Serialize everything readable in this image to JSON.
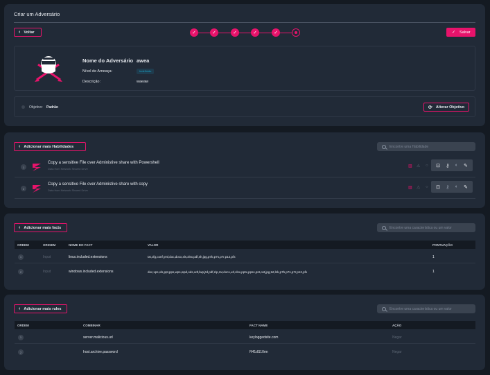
{
  "header": {
    "title": "Criar um Adversário",
    "back_label": "Voltar",
    "save_label": "Salvar",
    "steps": [
      "done",
      "done",
      "done",
      "done",
      "done",
      "current"
    ]
  },
  "adversary": {
    "name_label": "Nome do Adversário",
    "name_value": "awea",
    "threat_label": "Nível de Ameaça:",
    "threat_value": "Indefinido",
    "description_label": "Descrição:",
    "description_value": "waeaw"
  },
  "objective": {
    "label": "Objetivo:",
    "value": "Padrão",
    "change_label": "Alterar Objetivo"
  },
  "abilities": {
    "add_label": "Adicionar mais Habilidades",
    "search_placeholder": "Encontre uma Habilidade",
    "items": [
      {
        "index": "1",
        "title": "Copy a sensitive File over Administive share with Powershell",
        "subtitle": "Data from Network Shared Drive"
      },
      {
        "index": "2",
        "title": "Copy a sensitive File over Administive share with copy",
        "subtitle": "Data from Network Shared Drive"
      }
    ]
  },
  "facts": {
    "add_label": "Adicionar mais facts",
    "search_placeholder": "Encontre uma característica ou um valor",
    "columns": [
      "ORDEM",
      "ORIGEM",
      "NOME DO FACT",
      "VALOR",
      "PONTUAÇÃO"
    ],
    "rows": [
      {
        "order": "1",
        "origin": "Input",
        "name": "linux.included.extensions",
        "value": "txt,cfg,conf,yml,doc,docx,xls,xlsx,pdf,sh,jpg,p7b,p7s,p7r,p12,pfx",
        "score": "1"
      },
      {
        "order": "2",
        "origin": "Input",
        "name": "windows.included.extensions",
        "value": "doc,xps,xls,ppt,pps,wps,wpd,ods,odt,lwp,jtd,pdf,zip,rar,docx,url,xlsx,pptx,ppsx,pst,ost,jpg,txt,lnk,p7b,p7s,p7r,p12,pfx",
        "score": "1"
      }
    ]
  },
  "rules": {
    "add_label": "Adicionar mais rules",
    "search_placeholder": "Encontre uma característica ou um valor",
    "columns": [
      "ORDEM",
      "COMBINAR",
      "FACT NAME",
      "AÇÃO"
    ],
    "rows": [
      {
        "order": "1",
        "match": "server.malicious.url",
        "fact": "keyloggedsite.com",
        "action": "Negar"
      },
      {
        "order": "2",
        "match": "host.archive.password",
        "fact": "R41dS10rm",
        "action": "Negar"
      }
    ]
  },
  "colors": {
    "accent": "#e8136b",
    "background": "#141a22",
    "card": "#212a37",
    "threat_badge": "#1aa3c9"
  }
}
